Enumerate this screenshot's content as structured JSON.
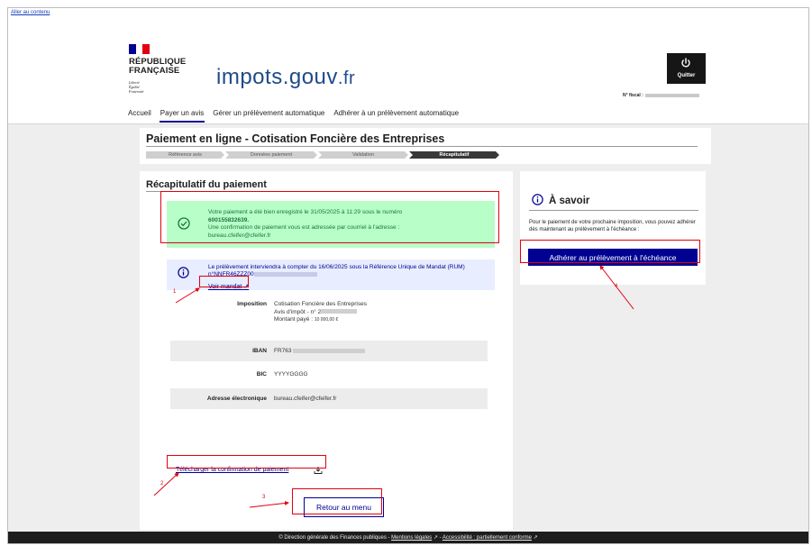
{
  "skip_link": "Aller au contenu",
  "header": {
    "flag_colors": [
      "#000091",
      "#ffffff",
      "#e1000f"
    ],
    "marianne_line1": "RÉPUBLIQUE",
    "marianne_line2": "FRANÇAISE",
    "devise": [
      "Liberté",
      "Égalité",
      "Fraternité"
    ],
    "site_logo_main": "impots.gouv",
    "site_logo_tld": ".fr",
    "quit_label": "Quitter",
    "fiscal_label": "N° fiscal :"
  },
  "nav": {
    "items": [
      "Accueil",
      "Payer un avis",
      "Gérer un prélèvement automatique",
      "Adhérer à un prélèvement automatique"
    ],
    "active_index": 1
  },
  "page": {
    "title": "Paiement en ligne - Cotisation Foncière des Entreprises",
    "steps": [
      "Référence avis",
      "Données paiement",
      "Validation",
      "Récapitulatif"
    ],
    "current_step_index": 3
  },
  "main": {
    "section_title": "Récapitulatif du paiement",
    "success": {
      "line1_pre": "Votre paiement a été bien enregistré le ",
      "date": "31/05/2025",
      "line1_mid": " à 11:29 sous le numéro",
      "number": "600155832639.",
      "line3": "Une confirmation de paiement vous est adressée par courriel à l'adresse :",
      "email": "bureau.cfeifer@cfeifer.fr"
    },
    "info": {
      "pre": "Le prélèvement interviendra à compter du ",
      "date": "16/06/2025",
      "mid": " sous la Référence Unique de Mandat (RUM) n°NNFR46ZZZ00"
    },
    "mandat_link": "Voir mandat",
    "imposition_label": "Imposition",
    "imposition_line1": "Cotisation Foncière des Entreprises",
    "imposition_line2": "Avis d'impôt - n° 2",
    "imposition_line3_label": "Montant payé :",
    "imposition_line3_value": "10 000,00 €",
    "iban_label": "IBAN",
    "iban_value": "FR763",
    "bic_label": "BIC",
    "bic_value": "YYYYGGGG",
    "email_label": "Adresse électronique",
    "email_value": "bureau.cfeifer@cfeifer.fr",
    "download_link": "Télécharger la confirmation de paiement",
    "back_button": "Retour au menu"
  },
  "side": {
    "title": "À savoir",
    "text": "Pour le paiement de votre prochaine imposition, vous pouvez adhérer dès maintenant au prélèvement à l'échéance :",
    "button": "Adhérer au prélèvement à l'échéance"
  },
  "footer": {
    "copyright": "© Direction générale des Finances publiques - ",
    "mentions": "Mentions légales",
    "sep": " - ",
    "accessibility": "Accessibilité : partiellement conforme"
  },
  "annotations": {
    "numbers": [
      "1",
      "2",
      "3",
      "4"
    ],
    "color": "#e1000f"
  },
  "colors": {
    "primary_blue": "#000091",
    "success_green": "#18753c",
    "success_bg": "#b8fec9",
    "info_bg": "#e8edff",
    "footer_bg": "#1e1e1e"
  }
}
